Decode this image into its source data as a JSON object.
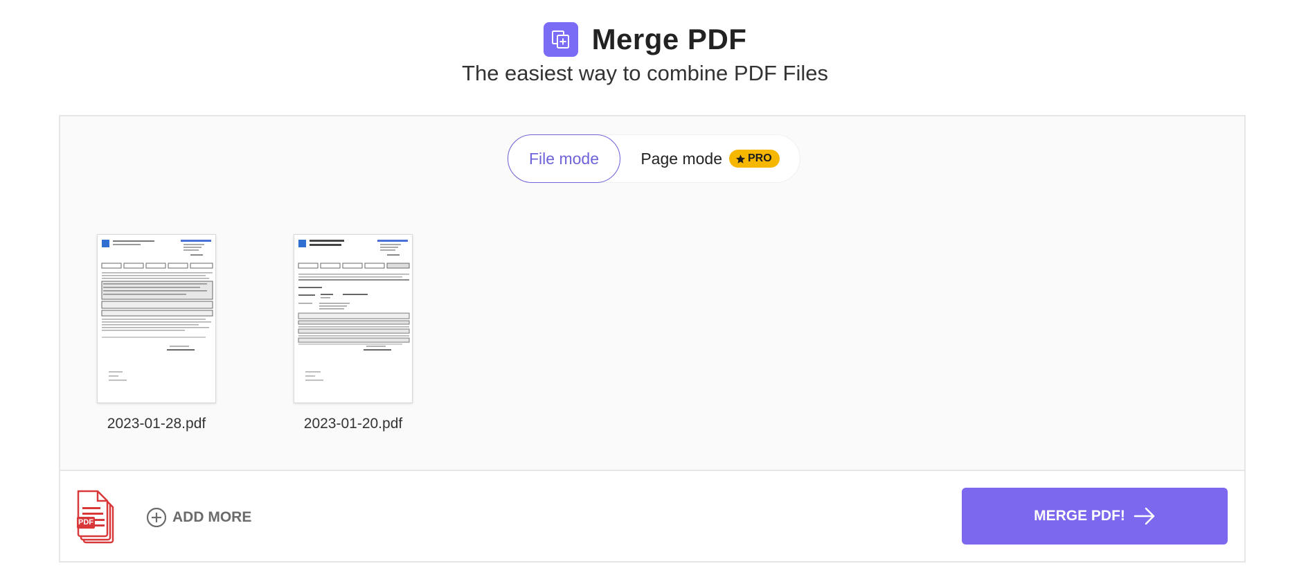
{
  "header": {
    "title": "Merge PDF",
    "subtitle": "The easiest way to combine PDF Files",
    "icon": "merge-files-icon"
  },
  "mode_toggle": {
    "file_mode_label": "File mode",
    "page_mode_label": "Page mode",
    "pro_badge": "PRO",
    "selected": "File mode"
  },
  "files": [
    {
      "name": "2023-01-28.pdf"
    },
    {
      "name": "2023-01-20.pdf"
    }
  ],
  "footer": {
    "add_more_label": "ADD MORE",
    "merge_label": "MERGE PDF!",
    "pdf_icon_text": "PDF"
  },
  "colors": {
    "accent": "#7b68ee",
    "toggle_border": "#6e63d8",
    "pro_badge": "#f5b700",
    "pdf_icon": "#d9383a"
  }
}
